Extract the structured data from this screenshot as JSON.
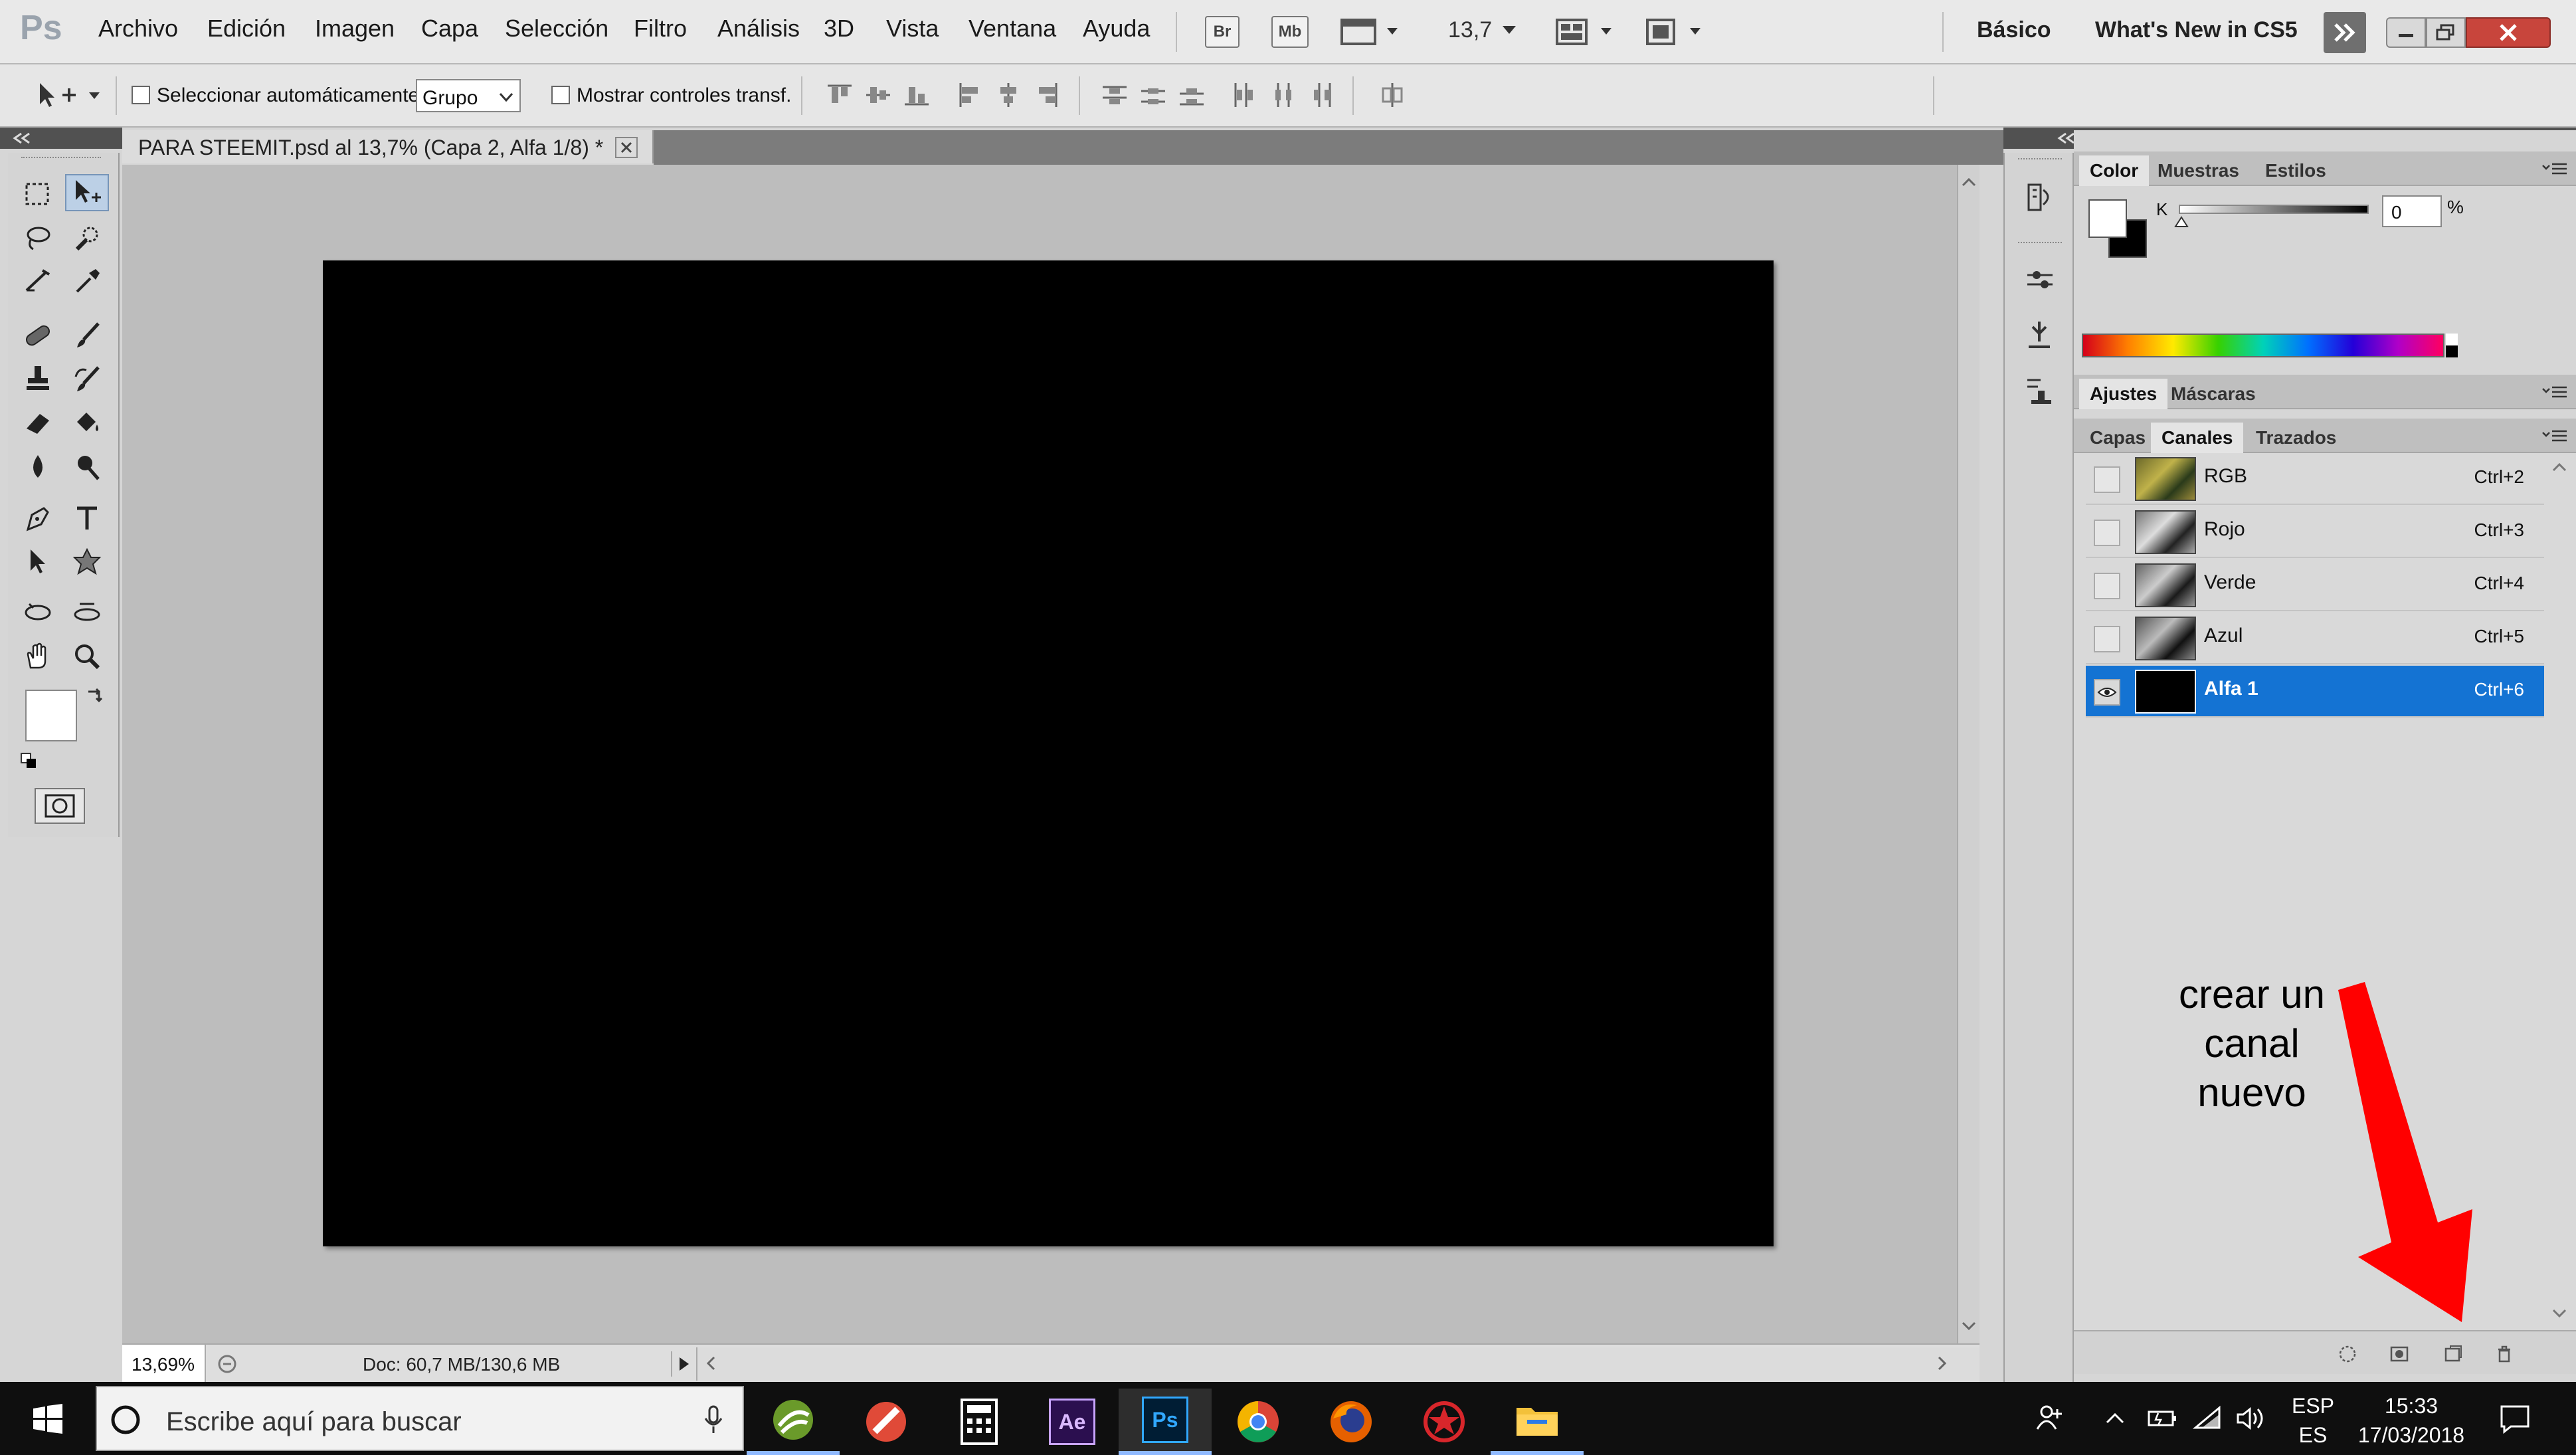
{
  "app": {
    "logo": "Ps",
    "menu": [
      "Archivo",
      "Edición",
      "Imagen",
      "Capa",
      "Selección",
      "Filtro",
      "Análisis",
      "3D",
      "Vista",
      "Ventana",
      "Ayuda"
    ],
    "bridge_label": "Br",
    "minibridge_label": "Mb",
    "zoom_value": "13,7",
    "workspaces": [
      "Básico",
      "What's New in CS5"
    ]
  },
  "options_bar": {
    "auto_select_label": "Seleccionar automáticamente:",
    "auto_select_value": "Grupo",
    "show_transform_label": "Mostrar controles transf."
  },
  "document": {
    "tab_title": "PARA STEEMIT.psd al 13,7% (Capa 2, Alfa 1/8) *",
    "zoom_status": "13,69%",
    "doc_size": "Doc: 60,7 MB/130,6 MB",
    "canvas_color": "#000000"
  },
  "color_panel": {
    "tabs": [
      "Color",
      "Muestras",
      "Estilos"
    ],
    "channel_label": "K",
    "value": "0",
    "unit": "%",
    "foreground": "#ffffff",
    "background": "#000000"
  },
  "adjust_panel": {
    "tabs": [
      "Ajustes",
      "Máscaras"
    ]
  },
  "channels_panel": {
    "tabs": [
      "Capas",
      "Canales",
      "Trazados"
    ],
    "channels": [
      {
        "name": "RGB",
        "shortcut": "Ctrl+2",
        "visible": false,
        "selected": false
      },
      {
        "name": "Rojo",
        "shortcut": "Ctrl+3",
        "visible": false,
        "selected": false
      },
      {
        "name": "Verde",
        "shortcut": "Ctrl+4",
        "visible": false,
        "selected": false
      },
      {
        "name": "Azul",
        "shortcut": "Ctrl+5",
        "visible": false,
        "selected": false
      },
      {
        "name": "Alfa 1",
        "shortcut": "Ctrl+6",
        "visible": true,
        "selected": true
      }
    ]
  },
  "annotation": {
    "lines": [
      "crear un",
      "canal",
      "nuevo"
    ],
    "arrow_color": "#ff0000"
  },
  "taskbar": {
    "search_placeholder": "Escribe aquí para buscar",
    "ae_label": "Ae",
    "ps_label": "Ps",
    "lang_top": "ESP",
    "lang_bottom": "ES",
    "time": "15:33",
    "date": "17/03/2018"
  },
  "colors": {
    "selection_blue": "#1473d3",
    "taskbar_bg": "#0f0f0f",
    "ps_blue": "#001d34",
    "ae_purple": "#2b0f4f"
  }
}
